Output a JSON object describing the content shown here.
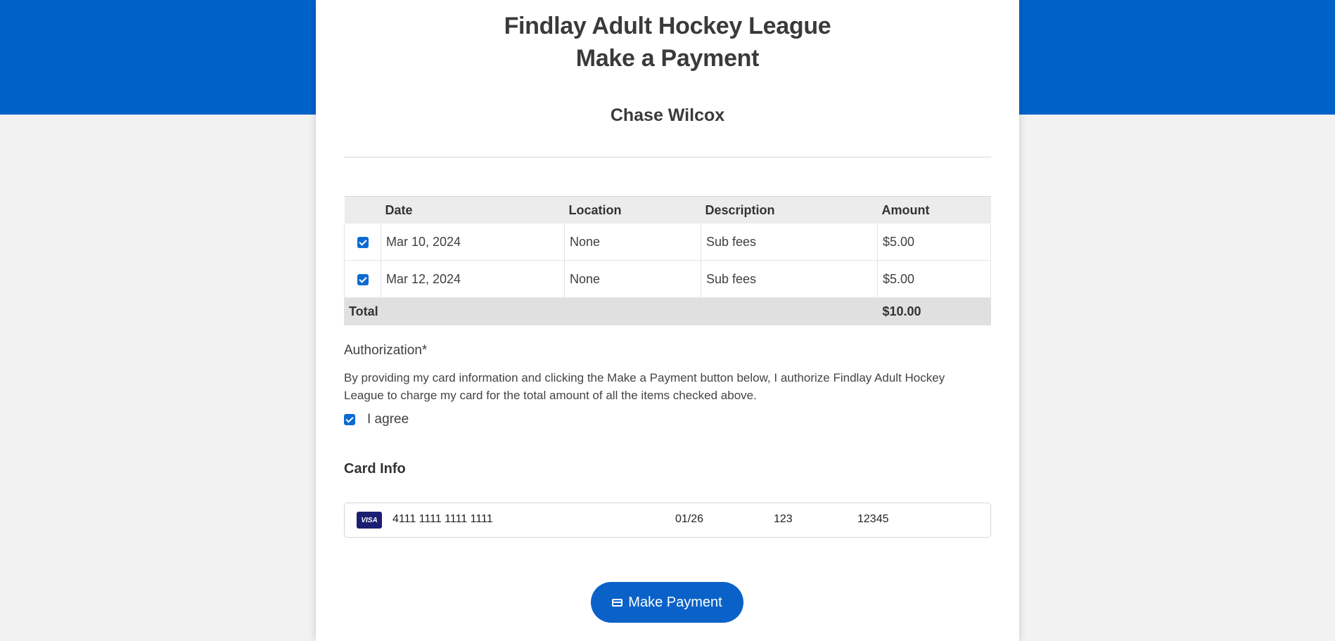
{
  "header": {
    "league_name": "Findlay Adult Hockey League",
    "page_title": "Make a Payment",
    "player_name": "Chase Wilcox"
  },
  "fees_table": {
    "columns": [
      "",
      "Date",
      "Location",
      "Description",
      "Amount"
    ],
    "rows": [
      {
        "checked": true,
        "date": "Mar 10, 2024",
        "location": "None",
        "description": "Sub fees",
        "amount": "$5.00"
      },
      {
        "checked": true,
        "date": "Mar 12, 2024",
        "location": "None",
        "description": "Sub fees",
        "amount": "$5.00"
      }
    ],
    "total_label": "Total",
    "total_amount": "$10.00"
  },
  "authorization": {
    "label": "Authorization*",
    "text": "By providing my card information and clicking the Make a Payment button below, I authorize Findlay Adult Hockey League to charge my card for the total amount of all the items checked above.",
    "agree_label": "I agree",
    "agree_checked": true
  },
  "card_info": {
    "title": "Card Info",
    "brand_icon": "visa-icon",
    "brand_text": "VISA",
    "number": "4111 1111 1111 1111",
    "expiry": "01/26",
    "cvc": "123",
    "zip": "12345"
  },
  "actions": {
    "pay_label": "Make Payment",
    "pay_icon": "credit-card-icon"
  },
  "colors": {
    "brand_blue": "#0062c9",
    "button_blue": "#0a62c9",
    "checkbox_blue": "#0b6bd3",
    "background": "#f2f2f2"
  }
}
